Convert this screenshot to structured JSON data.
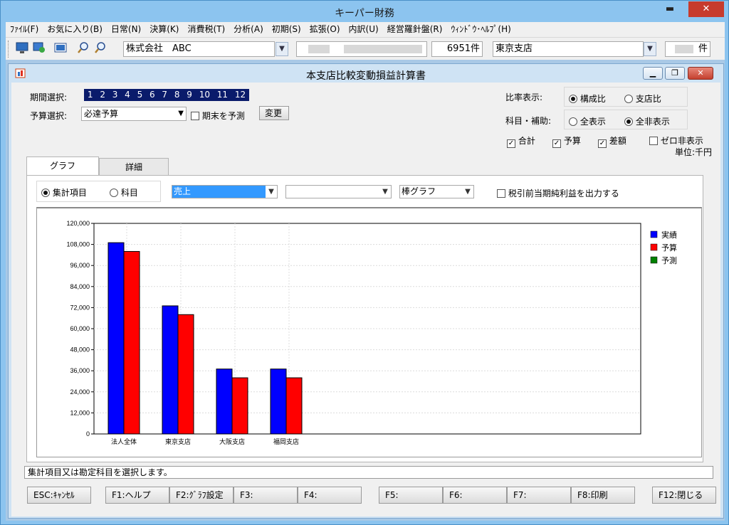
{
  "app": {
    "title": "キーパー財務"
  },
  "menu": [
    "ﾌｧｲﾙ(F)",
    "お気に入り(B)",
    "日常(N)",
    "決算(K)",
    "消費税(T)",
    "分析(A)",
    "初期(S)",
    "拡張(O)",
    "内訳(U)",
    "経営羅針盤(R)",
    "ｳｨﾝﾄﾞｳ･ﾍﾙﾌﾟ(H)"
  ],
  "toolbar": {
    "company": "株式会社　ABC",
    "count": "6951件",
    "branch": "東京支店",
    "unit_suffix": "件"
  },
  "report": {
    "title": "本支店比較変動損益計算書",
    "period_label": "期間選択:",
    "periods": [
      "1",
      "2",
      "3",
      "4",
      "5",
      "6",
      "7",
      "8",
      "9",
      "10",
      "11",
      "12"
    ],
    "budget_label": "予算選択:",
    "budget_value": "必達予算",
    "forecast_label": "期末を予測",
    "change_button": "変更",
    "ratio_label": "比率表示:",
    "ratio_options": [
      "構成比",
      "支店比"
    ],
    "subject_label": "科目・補助:",
    "subject_options": [
      "全表示",
      "全非表示"
    ],
    "checks": {
      "total": "合計",
      "budget": "予算",
      "diff": "差額",
      "zero": "ゼロ非表示"
    },
    "unit": "単位:千円"
  },
  "tabs": [
    "グラフ",
    "詳細"
  ],
  "graph_controls": {
    "mode_options": [
      "集計項目",
      "科目"
    ],
    "item_value": "売上",
    "sub_value": "",
    "chart_type": "棒グラフ",
    "pretax_label": "税引前当期純利益を出力する"
  },
  "chart_data": {
    "type": "bar",
    "categories": [
      "法人全体",
      "東京支店",
      "大阪支店",
      "福岡支店"
    ],
    "series": [
      {
        "name": "実績",
        "values": [
          109000,
          73000,
          37000,
          37000
        ],
        "color": "#0000ff"
      },
      {
        "name": "予算",
        "values": [
          104000,
          68000,
          32000,
          32000
        ],
        "color": "#ff0000"
      },
      {
        "name": "予測",
        "values": [
          0,
          0,
          0,
          0
        ],
        "color": "#008000"
      }
    ],
    "yticks": [
      "0",
      "12,000",
      "24,000",
      "36,000",
      "48,000",
      "60,000",
      "72,000",
      "84,000",
      "96,000",
      "108,000",
      "120,000"
    ],
    "ylim": [
      0,
      120000
    ],
    "grid": true,
    "legend": "top-right"
  },
  "status": "集計項目又は勘定科目を選択します。",
  "fkeys": [
    "ESC:ｷｬﾝｾﾙ",
    "F1:ヘルプ",
    "F2:ｸﾞﾗﾌ設定",
    "F3:",
    "F4:",
    "F5:",
    "F6:",
    "F7:",
    "F8:印刷",
    "F12:閉じる"
  ]
}
